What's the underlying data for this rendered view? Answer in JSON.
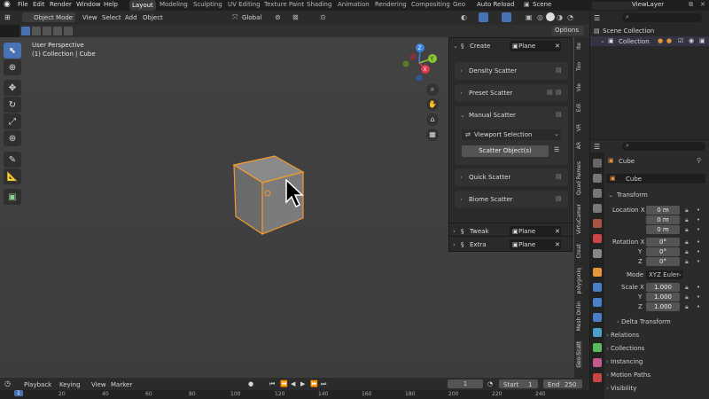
{
  "menubar": {
    "items": [
      "File",
      "Edit",
      "Render",
      "Window",
      "Help"
    ],
    "workspaces": [
      "Layout",
      "Modeling",
      "Sculpting",
      "UV Editing",
      "Texture Paint",
      "Shading",
      "Animation",
      "Rendering",
      "Compositing",
      "Geo"
    ],
    "active_workspace": "Layout",
    "auto_reload": "Auto Reload",
    "scene": "Scene",
    "view_layer": "ViewLayer"
  },
  "viewport_header": {
    "mode": "Object Mode",
    "menus": [
      "View",
      "Select",
      "Add",
      "Object"
    ],
    "orientation": "Global",
    "options": "Options"
  },
  "viewport": {
    "perspective": "User Perspective",
    "collection_info": "(1) Collection | Cube"
  },
  "gizmo": {
    "x": "X",
    "y": "Y",
    "z": "Z"
  },
  "scatter_panel": {
    "create_label": "Create",
    "create_target": "Plane",
    "items": [
      "Density Scatter",
      "Preset Scatter",
      "Manual Scatter"
    ],
    "viewport_selection": "Viewport Selection",
    "scatter_objects": "Scatter Object(s)",
    "quick_scatter": "Quick Scatter",
    "biome_scatter": "Biome Scatter",
    "tweak_label": "Tweak",
    "tweak_target": "Plane",
    "extra_label": "Extra",
    "extra_target": "Plane"
  },
  "side_tabs": [
    "Ite",
    "Too",
    "Vie",
    "Edi",
    "VR",
    "AR",
    "Quad Remes",
    "VirtuCamer",
    "Creat",
    "polygoniq",
    "Mesh Onlin",
    "Geo-Scatt"
  ],
  "outliner": {
    "scene_collection": "Scene Collection",
    "collection": "Collection"
  },
  "properties": {
    "object_name": "Cube",
    "data_name": "Cube",
    "transform": "Transform",
    "location_label": "Location X",
    "location": [
      "0 m",
      "0 m",
      "0 m"
    ],
    "rotation_label": "Rotation X",
    "rotation": [
      "0°",
      "0°",
      "0°"
    ],
    "mode_label": "Mode",
    "mode_value": "XYZ Euler",
    "scale_label": "Scale X",
    "scale": [
      "1.000",
      "1.000",
      "1.000"
    ],
    "axis_y": "Y",
    "axis_z": "Z",
    "sections": [
      "Delta Transform",
      "Relations",
      "Collections",
      "Instancing",
      "Motion Paths",
      "Visibility"
    ]
  },
  "timeline": {
    "menus": [
      "Playback",
      "Keying",
      "View",
      "Marker"
    ],
    "current_frame": "1",
    "start_label": "Start",
    "start": "1",
    "end_label": "End",
    "end": "250",
    "ruler": [
      "1",
      "20",
      "40",
      "60",
      "80",
      "100",
      "120",
      "140",
      "160",
      "180",
      "200",
      "220",
      "240"
    ]
  },
  "colors": {
    "accent": "#4772b3",
    "selection_orange": "#f39a2c",
    "gizmo_x": "#e2374d",
    "gizmo_y": "#8ac42e",
    "gizmo_z": "#3a83e2"
  }
}
